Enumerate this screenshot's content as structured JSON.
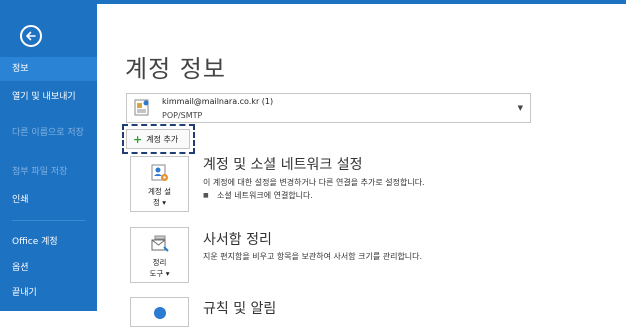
{
  "sidebar": {
    "items": [
      {
        "label": "정보"
      },
      {
        "label": "열기 및 내보내기"
      },
      {
        "label": "다른 이름으로 저장"
      },
      {
        "label": "첨부 파일 저장"
      },
      {
        "label": "인쇄"
      },
      {
        "label": "Office 계정"
      },
      {
        "label": "옵션"
      },
      {
        "label": "끝내기"
      }
    ]
  },
  "main": {
    "title": "계정 정보",
    "account": {
      "email": "kimmail@mailnara.co.kr (1)",
      "type": "POP/SMTP"
    },
    "add_account_label": "계정 추가",
    "sections": [
      {
        "tile_label_1": "계정 설",
        "tile_label_2": "정 ▾",
        "title": "계정 및 소셜 네트워크 설정",
        "desc": "이 계정에 대한 설정을 변경하거나 다른 연결을 추가로 설정합니다.",
        "bullet": "소셜 네트워크에 연결합니다."
      },
      {
        "tile_label_1": "정리",
        "tile_label_2": "도구 ▾",
        "title": "사서함 정리",
        "desc": "지운 편지함을 비우고 항목을 보관하여 사서함 크기를 관리합니다."
      },
      {
        "title": "규칙 및 알림"
      }
    ]
  },
  "colors": {
    "sidebar": "#1e72c2",
    "sidebar_active": "#2b83d5",
    "highlight_dash": "#1f3e74"
  }
}
